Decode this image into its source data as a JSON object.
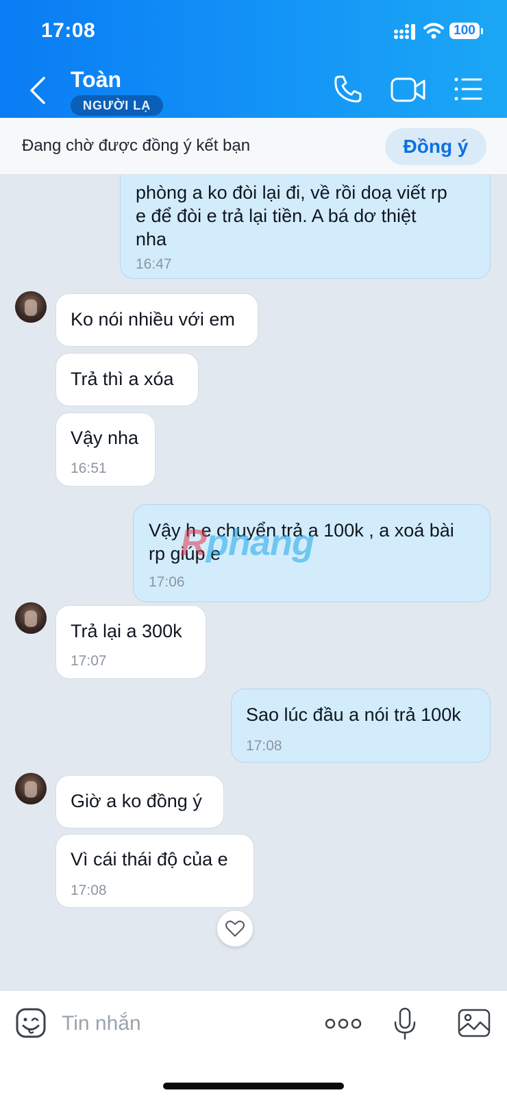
{
  "status_bar": {
    "time": "17:08",
    "battery": "100"
  },
  "header": {
    "contact_name": "Toàn",
    "badge": "NGƯỜI LẠ"
  },
  "friend_request": {
    "text": "Đang chờ được đồng ý kết bạn",
    "accept_label": "Đồng ý"
  },
  "messages": [
    {
      "side": "out",
      "lines": [
        "phòng a ko đòi lại đi, về rồi doạ viết rp",
        "e để đòi e trả lại tiền. A bá dơ thiệt",
        "nha"
      ],
      "time": "16:47"
    },
    {
      "side": "in",
      "lines": [
        "Ko nói nhiều với em"
      ],
      "time": ""
    },
    {
      "side": "in",
      "lines": [
        "Trả thì a xóa"
      ],
      "time": ""
    },
    {
      "side": "in",
      "lines": [
        "Vậy nha"
      ],
      "time": "16:51"
    },
    {
      "side": "out",
      "lines": [
        "Vậy h e chuyển trả a 100k , a xoá bài",
        "rp giúp e"
      ],
      "time": "17:06"
    },
    {
      "side": "in",
      "lines": [
        "Trả lại a 300k"
      ],
      "time": "17:07"
    },
    {
      "side": "out",
      "lines": [
        "Sao lúc đầu a nói trả 100k"
      ],
      "time": "17:08"
    },
    {
      "side": "in",
      "lines": [
        "Giờ a ko đồng ý"
      ],
      "time": ""
    },
    {
      "side": "in",
      "lines": [
        "Vì cái thái độ của e"
      ],
      "time": "17:08"
    }
  ],
  "watermark": {
    "first": "R",
    "rest": "phang"
  },
  "input": {
    "placeholder": "Tin nhắn"
  },
  "icons": {
    "back": "chevron-left-icon",
    "call": "phone-icon",
    "video": "video-camera-icon",
    "menu": "list-icon",
    "sticker": "sticker-face-icon",
    "more": "more-dots-icon",
    "mic": "microphone-icon",
    "image": "image-icon",
    "heart": "heart-icon"
  },
  "colors": {
    "header_start": "#0a7cf4",
    "header_end": "#1ba7f5",
    "outgoing_bubble": "#d3ecfb",
    "incoming_bubble": "#ffffff",
    "accent": "#0a72e0"
  }
}
